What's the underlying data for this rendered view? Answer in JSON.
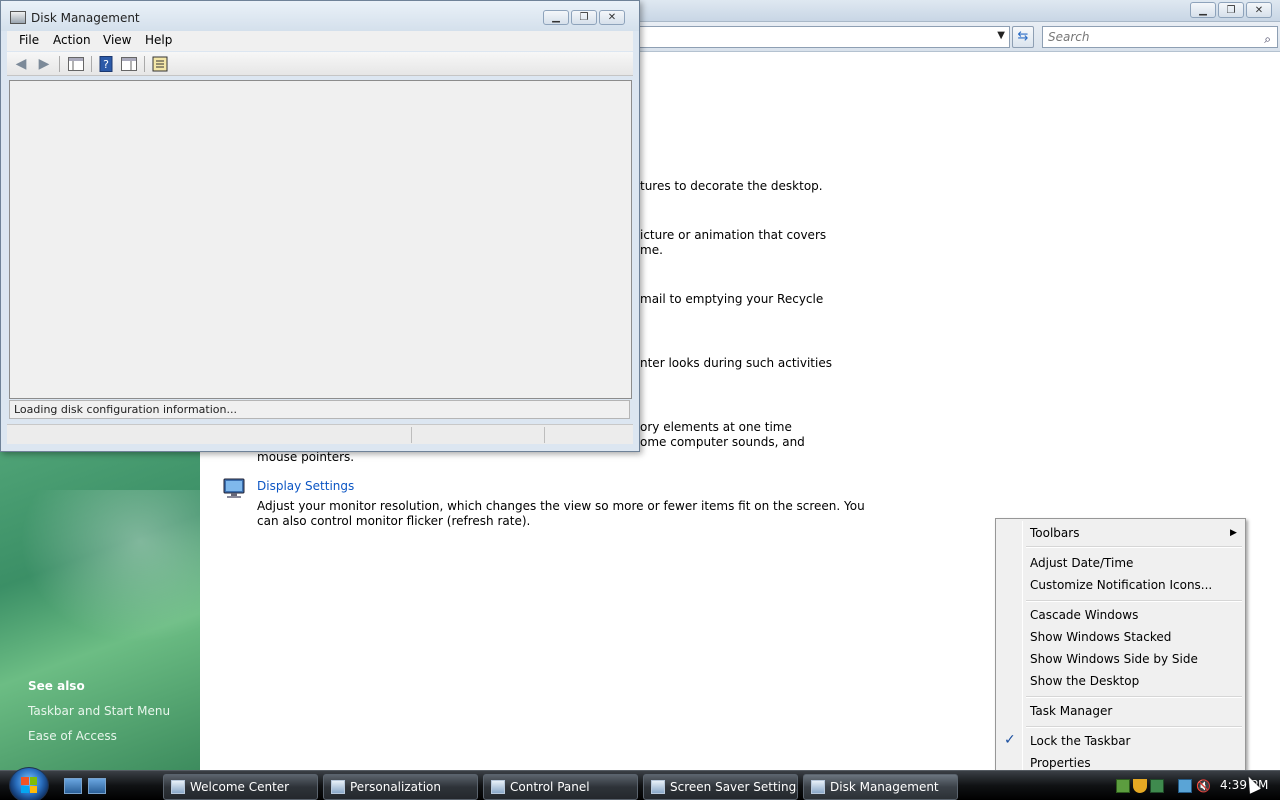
{
  "background_window": {
    "search_placeholder": "Search",
    "items": [
      {
        "line1": "tures to decorate the desktop.",
        "line2": ""
      },
      {
        "line1": "icture or animation that covers",
        "line2": "me."
      },
      {
        "line1": "mail to emptying your Recycle",
        "line2": ""
      },
      {
        "line1": "nter looks during such activities",
        "line2": ""
      },
      {
        "line1": "ory elements at one time",
        "line2": "ome computer sounds, and",
        "line3": "mouse pointers."
      }
    ],
    "display_settings": {
      "title": "Display Settings",
      "desc1": "Adjust your monitor resolution, which changes the view so more or fewer items fit on the screen. You",
      "desc2": "can also control monitor flicker (refresh rate)."
    },
    "see_also": {
      "heading": "See also",
      "links": [
        "Taskbar and Start Menu",
        "Ease of Access"
      ]
    }
  },
  "disk_management": {
    "title": "Disk Management",
    "menu": [
      "File",
      "Action",
      "View",
      "Help"
    ],
    "toolbar_icons": [
      "back-arrow-icon",
      "forward-arrow-icon",
      "console-tree-icon",
      "help-icon",
      "show-hide-icon",
      "properties-icon"
    ],
    "loading_text": "Loading disk configuration information..."
  },
  "taskbar": {
    "buttons": [
      "Welcome Center",
      "Personalization",
      "Control Panel",
      "Screen Saver Settings",
      "Disk Management"
    ],
    "clock": "4:39 PM"
  },
  "context_menu": {
    "items": [
      "Toolbars",
      "Adjust Date/Time",
      "Customize Notification Icons...",
      "Cascade Windows",
      "Show Windows Stacked",
      "Show Windows Side by Side",
      "Show the Desktop",
      "Task Manager",
      "Lock the Taskbar",
      "Properties"
    ],
    "checked_item": "Lock the Taskbar"
  },
  "colors": {
    "link": "#0b55c4",
    "sidebar_green": "#3b8f66"
  }
}
